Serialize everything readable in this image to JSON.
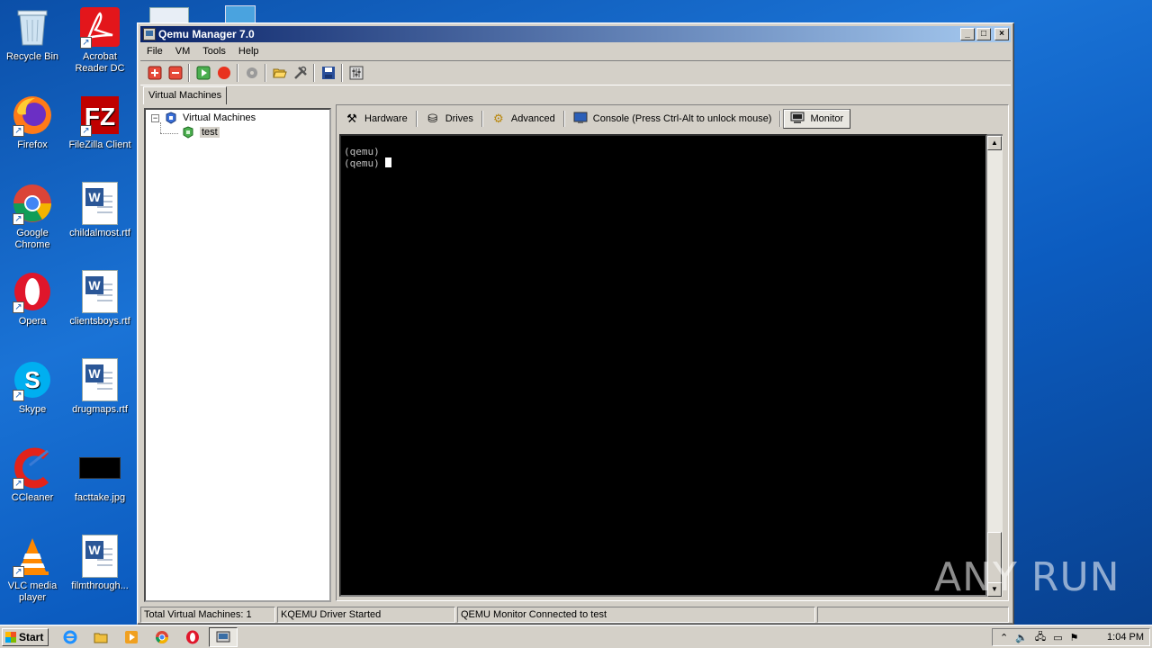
{
  "desktop": {
    "icons": [
      {
        "label": "Recycle Bin"
      },
      {
        "label": "Acrobat Reader DC"
      },
      {
        "label": "Firefox"
      },
      {
        "label": "FileZilla Client"
      },
      {
        "label": "Google Chrome"
      },
      {
        "label": "childalmost.rtf"
      },
      {
        "label": "Opera"
      },
      {
        "label": "clientsboys.rtf"
      },
      {
        "label": "Skype"
      },
      {
        "label": "drugmaps.rtf"
      },
      {
        "label": "CCleaner"
      },
      {
        "label": "facttake.jpg"
      },
      {
        "label": "VLC media player"
      },
      {
        "label": "filmthrough..."
      }
    ]
  },
  "window": {
    "title": "Qemu Manager 7.0",
    "controls": {
      "minimize": "_",
      "maximize": "□",
      "close": "×"
    }
  },
  "menu": {
    "file": "File",
    "vm": "VM",
    "tools": "Tools",
    "help": "Help"
  },
  "toolbar": {
    "icons": [
      "add-vm-icon",
      "remove-vm-icon",
      "play-icon",
      "stop-icon",
      "disk-icon",
      "open-folder-icon",
      "tools-icon",
      "save-icon",
      "settings-icon"
    ]
  },
  "main_tab": {
    "label": "Virtual Machines"
  },
  "tree": {
    "root_label": "Virtual Machines",
    "expander": "−",
    "child_label": "test"
  },
  "subtabs": {
    "hardware": "Hardware",
    "drives": "Drives",
    "advanced": "Advanced",
    "console": "Console (Press Ctrl-Alt to unlock mouse)",
    "monitor": "Monitor"
  },
  "console": {
    "lines": [
      "(qemu)",
      "(qemu)"
    ]
  },
  "statusbar": {
    "total": "Total Virtual Machines: 1",
    "driver": "KQEMU Driver Started",
    "monitor": "QEMU Monitor Connected to test",
    "empty": ""
  },
  "taskbar": {
    "start_label": "Start",
    "clock": "1:04 PM",
    "tray_arrow": "⌃"
  },
  "watermark": "ANY RUN",
  "colors": {
    "title_gradient_start": "#0a246a",
    "title_gradient_end": "#a6caf0",
    "console_bg": "#000000",
    "desktop_bg": "#1a73d6"
  }
}
